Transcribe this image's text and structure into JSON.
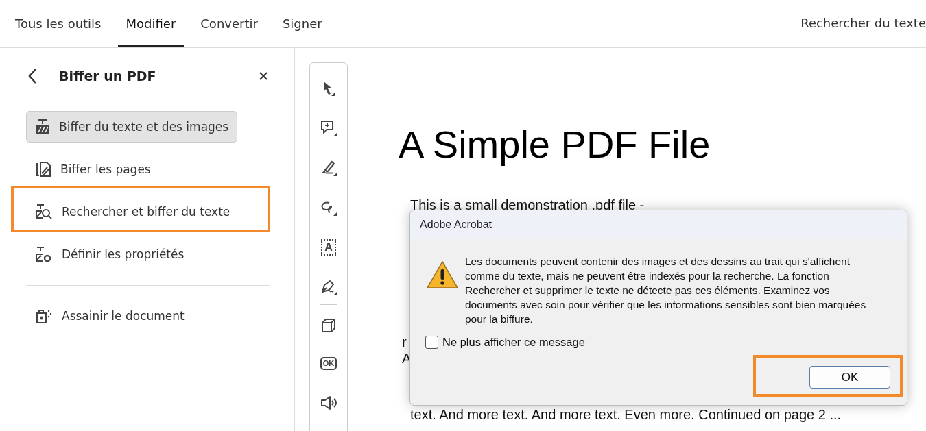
{
  "tabs": [
    {
      "label": "Tous les outils",
      "selected": false
    },
    {
      "label": "Modifier",
      "selected": true
    },
    {
      "label": "Convertir",
      "selected": false
    },
    {
      "label": "Signer",
      "selected": false
    }
  ],
  "search_link": "Rechercher du texte",
  "panel": {
    "title": "Biffer un PDF",
    "sections": [
      [
        {
          "kind": "redact-text",
          "label": "Biffer du texte et des images",
          "selected": true,
          "highlighted": false
        },
        {
          "kind": "redact-pages",
          "label": "Biffer les pages",
          "selected": false,
          "highlighted": false
        },
        {
          "kind": "search-redact",
          "label": "Rechercher et biffer du texte",
          "selected": false,
          "highlighted": true
        },
        {
          "kind": "properties",
          "label": "Définir les propriétés",
          "selected": false,
          "highlighted": false
        }
      ],
      [
        {
          "kind": "sanitize",
          "label": "Assainir le document",
          "selected": false,
          "highlighted": false
        }
      ]
    ]
  },
  "tools": [
    {
      "kind": "select"
    },
    {
      "kind": "comment"
    },
    {
      "kind": "highlight"
    },
    {
      "kind": "draw"
    },
    {
      "kind": "textfield",
      "glyph": "A"
    },
    {
      "kind": "sign"
    },
    {
      "kind": "divider"
    },
    {
      "kind": "cube"
    },
    {
      "kind": "button",
      "glyph": "OK"
    },
    {
      "kind": "sound"
    }
  ],
  "document": {
    "title": "A Simple PDF File",
    "first_line": "This is a small demonstration .pdf file -",
    "fragments": [
      "r",
      "A"
    ],
    "last_line": "text. And more text. And more text. Even more. Continued on page 2 ..."
  },
  "dialog": {
    "title": "Adobe Acrobat",
    "message": "Les documents peuvent contenir des images et des dessins au trait qui s'affichent comme du texte, mais ne peuvent être indexés pour la recherche. La fonction Rechercher et supprimer le texte ne détecte pas ces éléments. Examinez vos documents avec soin pour vérifier que les informations sensibles sont bien marquées pour la biffure.",
    "checkbox": {
      "label": "Ne plus afficher ce message",
      "checked": false
    },
    "ok": {
      "label": "OK",
      "highlighted": true
    }
  }
}
